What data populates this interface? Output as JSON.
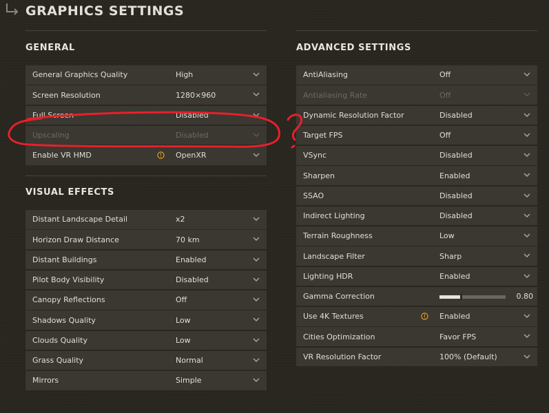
{
  "page_title": "GRAPHICS SETTINGS",
  "general": {
    "title": "GENERAL",
    "rows": [
      {
        "label": "General Graphics Quality",
        "value": "High"
      },
      {
        "label": "Screen Resolution",
        "value": "1280×960"
      },
      {
        "label": "Full Screen",
        "value": "Disabled"
      },
      {
        "label": "Upscaling",
        "value": "Disabled"
      },
      {
        "label": "Enable VR HMD",
        "value": "OpenXR"
      }
    ]
  },
  "visual_effects": {
    "title": "VISUAL EFFECTS",
    "rows": [
      {
        "label": "Distant Landscape Detail",
        "value": "x2"
      },
      {
        "label": "Horizon Draw Distance",
        "value": "70 km"
      },
      {
        "label": "Distant Buildings",
        "value": "Enabled"
      },
      {
        "label": "Pilot Body Visibility",
        "value": "Disabled"
      },
      {
        "label": "Canopy Reflections",
        "value": "Off"
      },
      {
        "label": "Shadows Quality",
        "value": "Low"
      },
      {
        "label": "Clouds Quality",
        "value": "Low"
      },
      {
        "label": "Grass Quality",
        "value": "Normal"
      },
      {
        "label": "Mirrors",
        "value": "Simple"
      }
    ]
  },
  "advanced": {
    "title": "ADVANCED SETTINGS",
    "rows": [
      {
        "label": "AntiAliasing",
        "value": "Off"
      },
      {
        "label": "Antialiasing Rate",
        "value": "Off"
      },
      {
        "label": "Dynamic Resolution Factor",
        "value": "Disabled"
      },
      {
        "label": "Target FPS",
        "value": "Off"
      },
      {
        "label": "VSync",
        "value": "Disabled"
      },
      {
        "label": "Sharpen",
        "value": "Enabled"
      },
      {
        "label": "SSAO",
        "value": "Disabled"
      },
      {
        "label": "Indirect Lighting",
        "value": "Disabled"
      },
      {
        "label": "Terrain Roughness",
        "value": "Low"
      },
      {
        "label": "Landscape Filter",
        "value": "Sharp"
      },
      {
        "label": "Lighting HDR",
        "value": "Enabled"
      },
      {
        "label": "Gamma Correction",
        "value": "0.80",
        "slider_fraction": 0.32
      },
      {
        "label": "Use 4K Textures",
        "value": "Enabled"
      },
      {
        "label": "Cities Optimization",
        "value": "Favor FPS"
      },
      {
        "label": "VR Resolution Factor",
        "value": "100% (Default)"
      }
    ]
  },
  "colors": {
    "background": "#28261f",
    "row_background": "#3a3831",
    "warning_icon": "#e0a020",
    "annotation_red": "#e8202a",
    "disabled_text": "#6d6a61"
  },
  "annotation_mark": "?"
}
